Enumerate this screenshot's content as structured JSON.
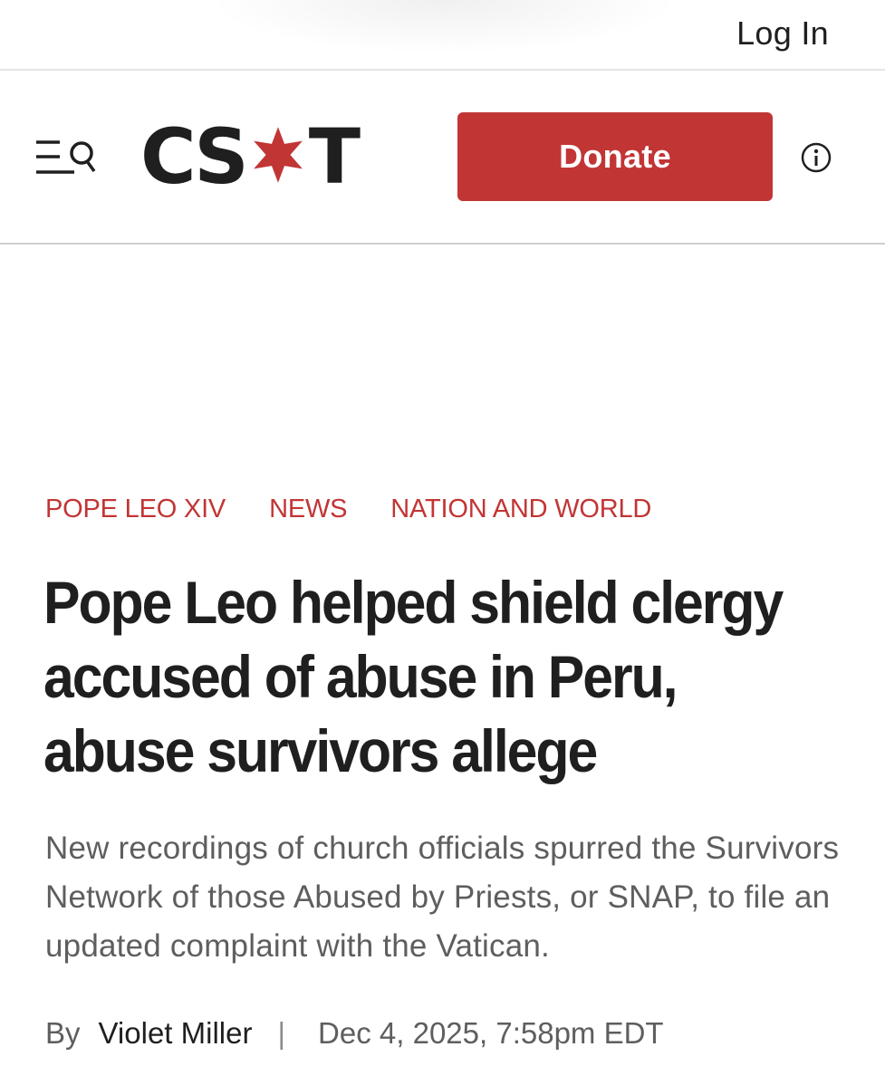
{
  "topbar": {
    "login_label": "Log In"
  },
  "header": {
    "menu_icon": "menu-search-icon",
    "logo_text_left": "CS",
    "logo_text_right": "T",
    "logo_star_icon": "red-six-point-star",
    "donate_label": "Donate",
    "info_icon": "info-circle-icon"
  },
  "colors": {
    "accent_red": "#c23535",
    "text_dark": "#1f1f1f",
    "text_gray": "#5e5e5e"
  },
  "article": {
    "sections": [
      "POPE LEO XIV",
      "NEWS",
      "NATION AND WORLD"
    ],
    "headline": "Pope Leo helped shield clergy accused of abuse in Peru, abuse survivors allege",
    "dek": "New recordings of church officials spurred the Survivors Network of those Abused by Priests, or SNAP, to file an updated complaint with the Vatican.",
    "byline_prefix": "By",
    "author": "Violet Miller",
    "separator": "|",
    "date": "Dec 4, 2025, 7:58pm EDT"
  }
}
